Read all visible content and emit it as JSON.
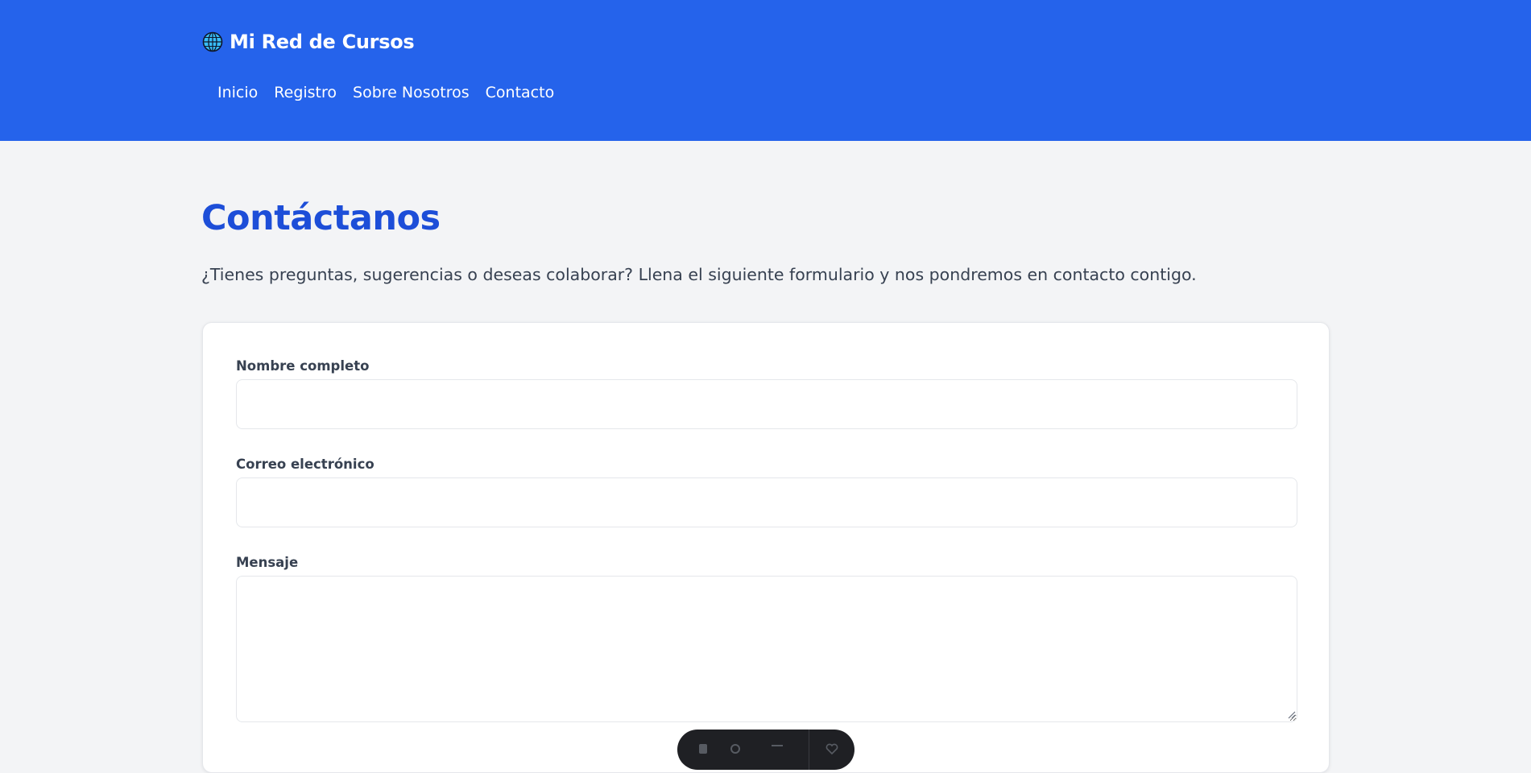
{
  "header": {
    "brand_title": "Mi Red de Cursos",
    "brand_icon": "globe-icon",
    "nav": [
      {
        "label": "Inicio"
      },
      {
        "label": "Registro"
      },
      {
        "label": "Sobre Nosotros"
      },
      {
        "label": "Contacto"
      }
    ]
  },
  "main": {
    "title": "Contáctanos",
    "intro": "¿Tienes preguntas, sugerencias o deseas colaborar? Llena el siguiente formulario y nos pondremos en contacto contigo.",
    "form": {
      "name_label": "Nombre completo",
      "name_value": "",
      "email_label": "Correo electrónico",
      "email_value": "",
      "message_label": "Mensaje",
      "message_value": ""
    }
  },
  "colors": {
    "header_bg": "#2563eb",
    "title": "#1d4ed8",
    "page_bg": "#f3f4f6"
  }
}
